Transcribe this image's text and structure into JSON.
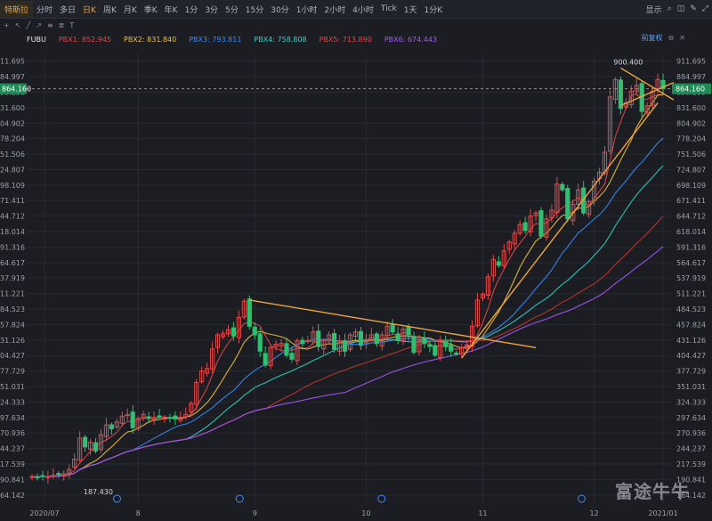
{
  "toolbar": {
    "timeframes": [
      "特斯拉",
      "分时",
      "多日",
      "日K",
      "周K",
      "月K",
      "季K",
      "年K",
      "1分",
      "3分",
      "5分",
      "15分",
      "30分",
      "1小时",
      "2小时",
      "4小时",
      "Tick",
      "1天",
      "1分K"
    ],
    "active_index": 0,
    "highlight_index": 3,
    "right": [
      "显示"
    ]
  },
  "legend": {
    "symbol": "FUBU",
    "items": [
      {
        "label": "PBX1: 852.945",
        "color": "#e64747"
      },
      {
        "label": "PBX2: 831.840",
        "color": "#f0c23a"
      },
      {
        "label": "PBX3: 793.811",
        "color": "#3a8dff"
      },
      {
        "label": "PBX4: 758.808",
        "color": "#2fd3c4"
      },
      {
        "label": "PBX5: 713.890",
        "color": "#e64747"
      },
      {
        "label": "PBX6: 674.443",
        "color": "#a757ff"
      }
    ],
    "right_label": "前复权"
  },
  "watermark": "富途牛牛",
  "colors": {
    "up": "#e04a4a",
    "down": "#2fbf71",
    "bg": "#1b1d23",
    "grid": "#262a33",
    "trend": "#f0a53a"
  },
  "chart_data": {
    "type": "candlestick",
    "ylim": [
      150,
      925
    ],
    "y_ticks": [
      "911.695",
      "884.997",
      "858.299",
      "831.600",
      "804.902",
      "778.204",
      "751.506",
      "724.807",
      "698.109",
      "671.411",
      "644.712",
      "618.014",
      "591.316",
      "564.617",
      "537.919",
      "511.221",
      "484.523",
      "457.824",
      "431.126",
      "404.427",
      "377.729",
      "351.031",
      "324.333",
      "297.634",
      "270.936",
      "244.237",
      "217.539",
      "190.841",
      "164.142"
    ],
    "x_labels": [
      "2020/07",
      "8",
      "9",
      "10",
      "11",
      "12",
      "2021/01"
    ],
    "current_price": "864.160",
    "high_label": "900.400",
    "low_label": "187.430",
    "closes": [
      196,
      195,
      197,
      196,
      198,
      199,
      201,
      208,
      226,
      262,
      247,
      255,
      240,
      268,
      285,
      278,
      290,
      300,
      303,
      280,
      296,
      303,
      296,
      298,
      298,
      298,
      297,
      295,
      298,
      303,
      322,
      358,
      378,
      382,
      416,
      440,
      442,
      449,
      438,
      470,
      498,
      455,
      440,
      412,
      388,
      418,
      424,
      425,
      405,
      398,
      430,
      425,
      430,
      445,
      420,
      430,
      440,
      415,
      430,
      412,
      440,
      445,
      422,
      432,
      440,
      425,
      440,
      455,
      445,
      430,
      450,
      440,
      410,
      430,
      425,
      420,
      405,
      430,
      420,
      412,
      408,
      418,
      423,
      455,
      500,
      510,
      540,
      570,
      560,
      585,
      600,
      615,
      630,
      620,
      645,
      650,
      610,
      640,
      655,
      700,
      690,
      640,
      665,
      690,
      650,
      670,
      705,
      720,
      755,
      850,
      880,
      830,
      840,
      860,
      870,
      825,
      835,
      860,
      880,
      864
    ]
  }
}
